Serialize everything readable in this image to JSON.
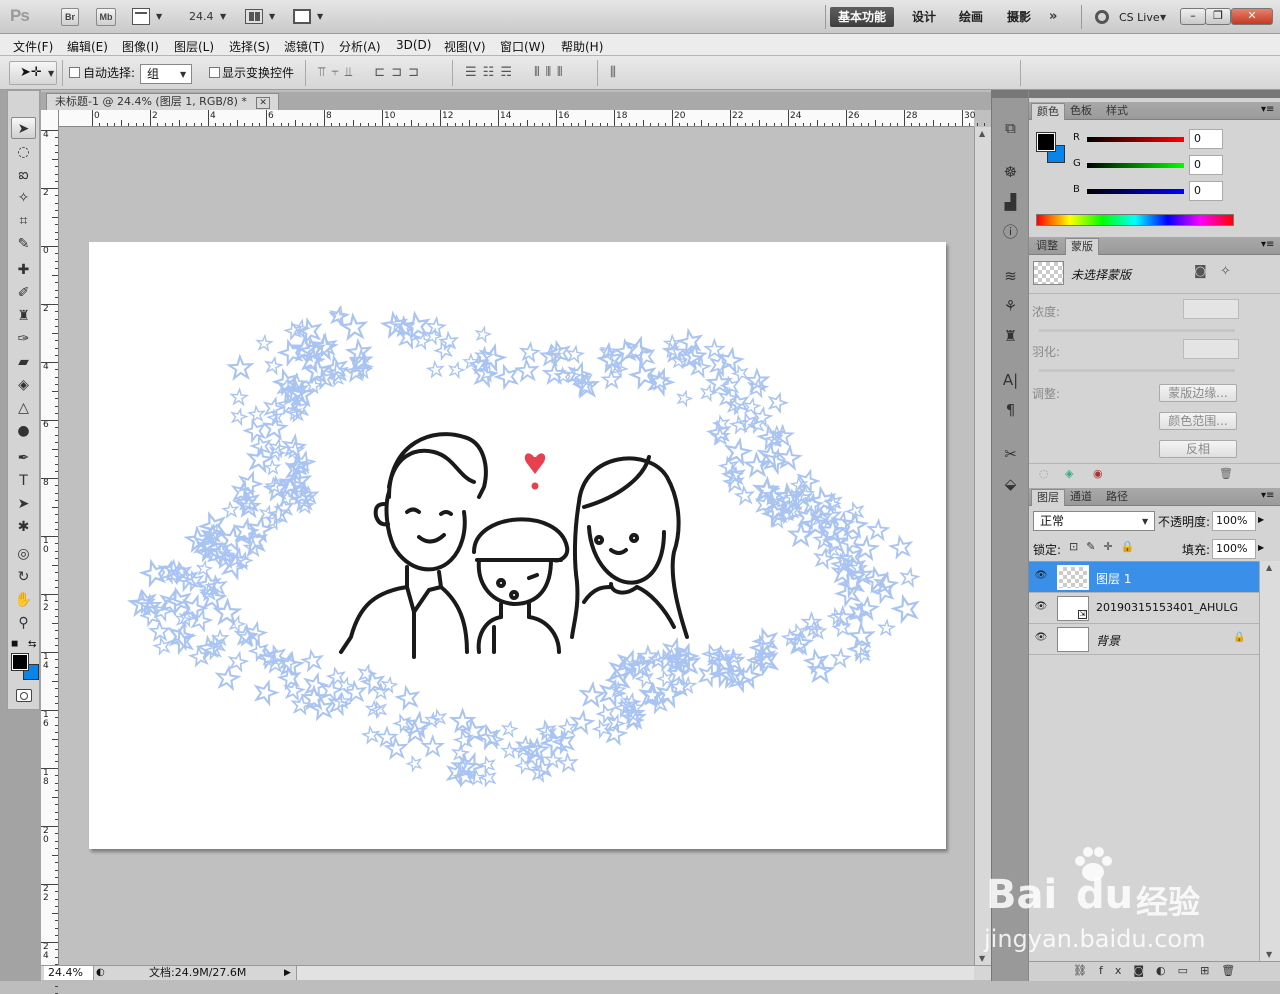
{
  "app": {
    "logo": "Ps",
    "bridge_label": "Br",
    "minibridge_label": "Mb",
    "zoom_value": "24.4",
    "workspaces": [
      "基本功能",
      "设计",
      "绘画",
      "摄影"
    ],
    "cslive_label": "CS Live"
  },
  "menus": [
    "文件(F)",
    "编辑(E)",
    "图像(I)",
    "图层(L)",
    "选择(S)",
    "滤镜(T)",
    "分析(A)",
    "3D(D)",
    "视图(V)",
    "窗口(W)",
    "帮助(H)"
  ],
  "options": {
    "auto_select_label": "自动选择:",
    "auto_select_value": "组",
    "show_transform_label": "显示变换控件"
  },
  "document": {
    "tab_title": "未标题-1 @ 24.4% (图层 1, RGB/8) *",
    "ruler_h_labels": [
      "0",
      "2",
      "4",
      "6",
      "8",
      "10",
      "12",
      "14",
      "16",
      "18",
      "20",
      "22",
      "24",
      "26",
      "28",
      "30"
    ],
    "ruler_v_labels": [
      "4",
      "2",
      "0",
      "2",
      "4",
      "6",
      "8",
      "10",
      "12",
      "14",
      "16",
      "18",
      "20",
      "22",
      "24"
    ],
    "status_zoom": "24.4%",
    "status_doc": "文档:24.9M/27.6M"
  },
  "color_panel": {
    "tabs": [
      "颜色",
      "色板",
      "样式"
    ],
    "r_label": "R",
    "g_label": "G",
    "b_label": "B",
    "r_value": "0",
    "g_value": "0",
    "b_value": "0",
    "foreground": "#000000",
    "background": "#0a84e8"
  },
  "masks_panel": {
    "tabs": [
      "调整",
      "蒙版"
    ],
    "no_mask_label": "未选择蒙版",
    "density_label": "浓度:",
    "feather_label": "羽化:",
    "refine_label": "调整:",
    "mask_edge_button": "蒙版边缘...",
    "color_range_button": "颜色范围...",
    "invert_button": "反相"
  },
  "layers_panel": {
    "tabs": [
      "图层",
      "通道",
      "路径"
    ],
    "blend_mode": "正常",
    "opacity_label": "不透明度:",
    "opacity_value": "100%",
    "lock_label": "锁定:",
    "fill_label": "填充:",
    "fill_value": "100%",
    "layers": [
      {
        "name": "图层 1",
        "selected": true
      },
      {
        "name": "20190315153401_AHULG",
        "selected": false
      },
      {
        "name": "背景",
        "selected": false
      }
    ]
  },
  "watermark": {
    "brand": "Bai",
    "brand2": "du",
    "brand_cn": "经验",
    "url": "jingyan.baidu.com"
  },
  "accent_colors": {
    "selection_blue": "#3a8fe8",
    "star_blue": "#a9c4f2",
    "heart_red": "#e8404e"
  }
}
